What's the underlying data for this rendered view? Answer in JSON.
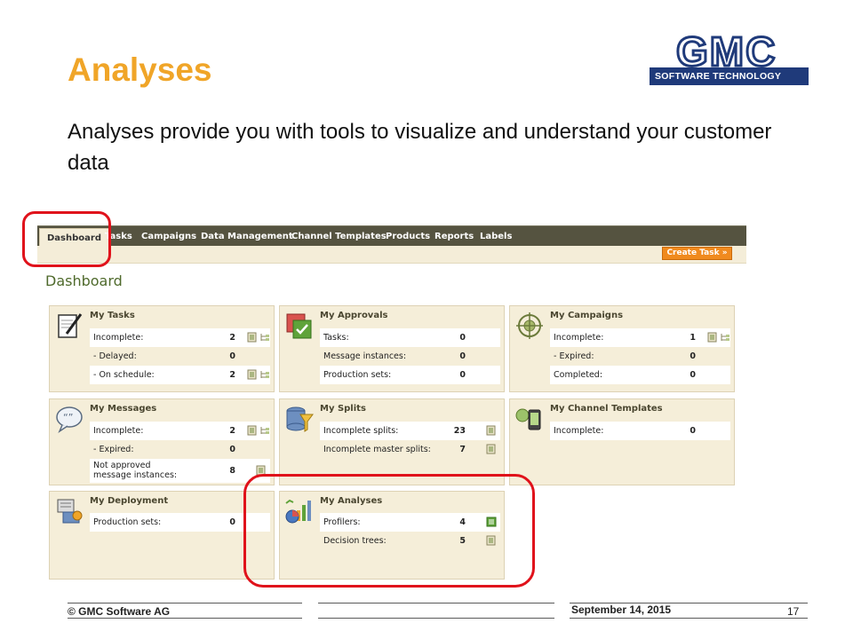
{
  "slide": {
    "title": "Analyses",
    "subtitle": "Analyses provide you with tools to visualize and understand your customer data"
  },
  "logo": {
    "letters": "GMC",
    "tagline": "SOFTWARE TECHNOLOGY"
  },
  "app": {
    "nav": [
      "Dashboard",
      "Tasks",
      "Campaigns",
      "Data Management",
      "Channel Templates",
      "Products",
      "Reports",
      "Labels"
    ],
    "active_tab": "Dashboard",
    "create_task_label": "Create Task »",
    "page_heading": "Dashboard",
    "widgets": {
      "tasks": {
        "title": "My Tasks",
        "rows": [
          {
            "label": "Incomplete:",
            "value": "2"
          },
          {
            "label": "- Delayed:",
            "value": "0"
          },
          {
            "label": "- On schedule:",
            "value": "2"
          }
        ]
      },
      "approvals": {
        "title": "My Approvals",
        "rows": [
          {
            "label": "Tasks:",
            "value": "0"
          },
          {
            "label": "Message instances:",
            "value": "0"
          },
          {
            "label": "Production sets:",
            "value": "0"
          }
        ]
      },
      "campaigns": {
        "title": "My Campaigns",
        "rows": [
          {
            "label": "Incomplete:",
            "value": "1"
          },
          {
            "label": "- Expired:",
            "value": "0"
          },
          {
            "label": "Completed:",
            "value": "0"
          }
        ]
      },
      "messages": {
        "title": "My Messages",
        "rows": [
          {
            "label": "Incomplete:",
            "value": "2"
          },
          {
            "label": "- Expired:",
            "value": "0"
          },
          {
            "label": "Not approved message instances:",
            "value": "8"
          }
        ]
      },
      "splits": {
        "title": "My Splits",
        "rows": [
          {
            "label": "Incomplete splits:",
            "value": "23"
          },
          {
            "label": "Incomplete master splits:",
            "value": "7"
          }
        ]
      },
      "channel_templates": {
        "title": "My Channel Templates",
        "rows": [
          {
            "label": "Incomplete:",
            "value": "0"
          }
        ]
      },
      "deployment": {
        "title": "My Deployment",
        "rows": [
          {
            "label": "Production sets:",
            "value": "0"
          }
        ]
      },
      "analyses": {
        "title": "My Analyses",
        "rows": [
          {
            "label": "Profilers:",
            "value": "4"
          },
          {
            "label": "Decision trees:",
            "value": "5"
          }
        ]
      }
    }
  },
  "footer": {
    "copyright": "© GMC Software AG",
    "date": "September 14, 2015",
    "page_number": "17"
  },
  "colors": {
    "title": "#f0a528",
    "navbar": "#555340",
    "panel": "#f5eed9",
    "create_task": "#f08a1e",
    "highlight": "#e0121b",
    "logo_blue": "#1f3a7a"
  }
}
